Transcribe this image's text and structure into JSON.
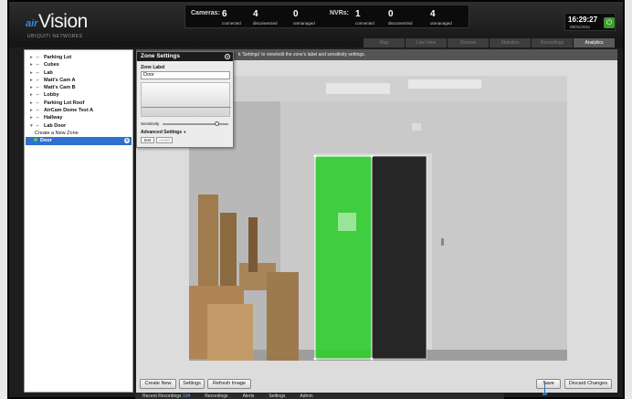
{
  "header": {
    "brand_prefix": "air",
    "brand": "Vision",
    "brand_sub": "UBIQUITI NETWORKS",
    "cameras_label": "Cameras:",
    "cameras_connected": "6",
    "cameras_connected_label": "connected",
    "cameras_disconnected": "4",
    "cameras_disconnected_label": "disconnected",
    "cameras_unmanaged": "0",
    "cameras_unmanaged_label": "unmanaged",
    "nvrs_label": "NVRs:",
    "nvrs_connected": "1",
    "nvrs_connected_label": "connected",
    "nvrs_disconnected": "0",
    "nvrs_disconnected_label": "disconnected",
    "nvrs_unmanaged": "4",
    "nvrs_unmanaged_label": "unmanaged",
    "time": "16:29:27",
    "date": "08/31/2011",
    "tabs": [
      "Map",
      "Live View",
      "Devices",
      "Statistics",
      "Recordings",
      "Analytics"
    ],
    "active_tab": "Analytics"
  },
  "sidebar": {
    "items": [
      {
        "label": "Parking Lot"
      },
      {
        "label": "Cubes"
      },
      {
        "label": "Lab"
      },
      {
        "label": "Matt's Cam A"
      },
      {
        "label": "Matt's Cam B"
      },
      {
        "label": "Lobby"
      },
      {
        "label": "Parking Lot Roof"
      },
      {
        "label": "AirCam Dome Test A"
      },
      {
        "label": "Hallway"
      },
      {
        "label": "Lab Door"
      }
    ],
    "create_zone": "Create a New Zone",
    "selected_zone": "Door"
  },
  "main": {
    "instruction": "k 'Settings' to view/edit the zone's label and sensitivity settings.",
    "create_new": "Create New",
    "settings": "Settings",
    "refresh_image": "Refresh Image",
    "save": "Save",
    "discard_changes": "Discard Changes"
  },
  "zone_settings": {
    "title": "Zone Settings",
    "label_heading": "Zone Label",
    "label_value": "Door",
    "sensitivity_label": "Sensitivity",
    "sensitivity": 0.85,
    "advanced": "Advanced Settings",
    "advanced_arrow": "▼",
    "test": "test",
    "revert": "revert"
  },
  "footer": {
    "tabs": [
      "Recent Recordings",
      "Recordings",
      "Alerts",
      "Settings",
      "Admin"
    ],
    "recent_count": "104"
  },
  "colors": {
    "accent": "#2f6fcf",
    "zone_green": "#33cc33",
    "zone_dark": "#222222"
  }
}
